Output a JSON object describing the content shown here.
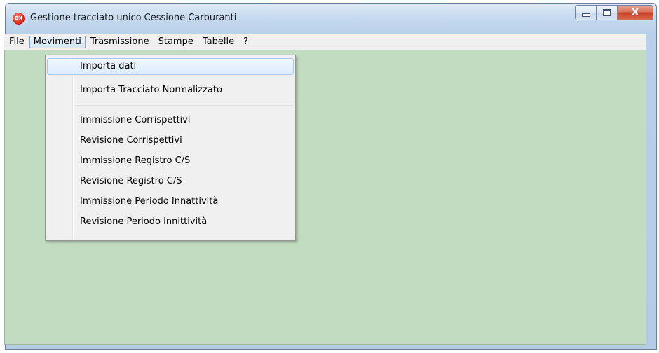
{
  "window": {
    "title": "Gestione tracciato unico Cessione Carburanti",
    "app_icon_label": "DX",
    "close_glyph": "X"
  },
  "menubar": {
    "items": [
      "File",
      "Movimenti",
      "Trasmissione",
      "Stampe",
      "Tabelle",
      "?"
    ],
    "active_index": 1
  },
  "movimenti_menu": {
    "group1": [
      "Importa dati",
      "Importa Tracciato Normalizzato"
    ],
    "group2": [
      "Immissione Corrispettivi",
      "Revisione Corrispettivi",
      "Immissione Registro C/S",
      "Revisione Registro C/S",
      "Immissione Periodo Innattività",
      "Revisione Periodo Innittività"
    ]
  },
  "colors": {
    "client_background": "#c1dcc0",
    "menu_highlight": "#dcebfc",
    "close_button": "#c74027"
  }
}
